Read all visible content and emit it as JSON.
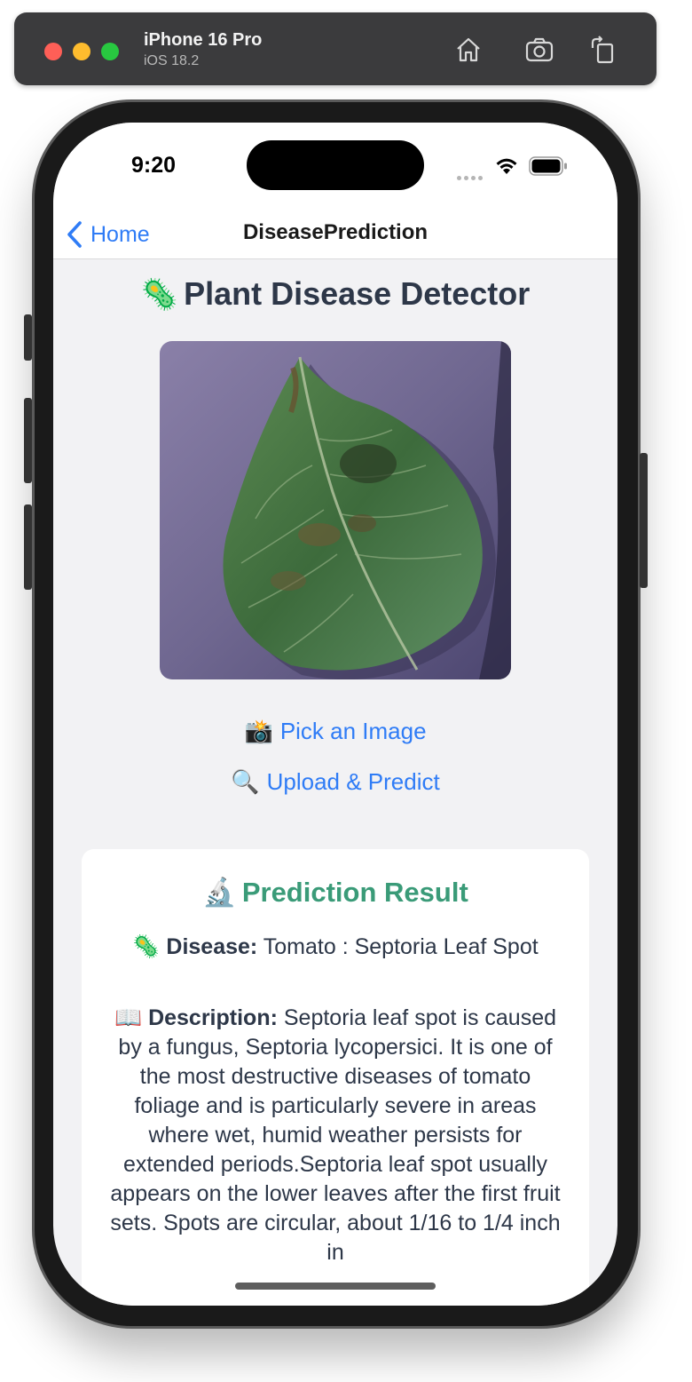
{
  "simulator": {
    "device": "iPhone 16 Pro",
    "os": "iOS 18.2",
    "icons": [
      "home-icon",
      "screenshot-icon",
      "rotate-icon"
    ]
  },
  "status_bar": {
    "time": "9:20"
  },
  "nav": {
    "back_label": "Home",
    "title": "DiseasePrediction"
  },
  "main": {
    "title_emoji": "🦠",
    "title": "Plant Disease Detector",
    "pick_emoji": "📸",
    "pick_label": "Pick an Image",
    "upload_emoji": "🔍",
    "upload_label": "Upload & Predict"
  },
  "result": {
    "title_emoji": "🔬",
    "title": "Prediction Result",
    "disease_emoji": "🦠",
    "disease_label": "Disease:",
    "disease_value": "Tomato : Septoria Leaf Spot",
    "description_emoji": "📖",
    "description_label": "Description:",
    "description_value": "Septoria leaf spot is caused by a fungus, Septoria lycopersici. It is one of the most destructive diseases of tomato foliage and is particularly severe in areas where wet, humid weather persists for extended periods.Septoria leaf spot usually appears on the lower leaves after the first fruit sets. Spots are circular, about 1/16 to 1/4 inch in"
  },
  "colors": {
    "link": "#2f7cf6",
    "result_title": "#3a9b78",
    "heading": "#2d3748"
  }
}
